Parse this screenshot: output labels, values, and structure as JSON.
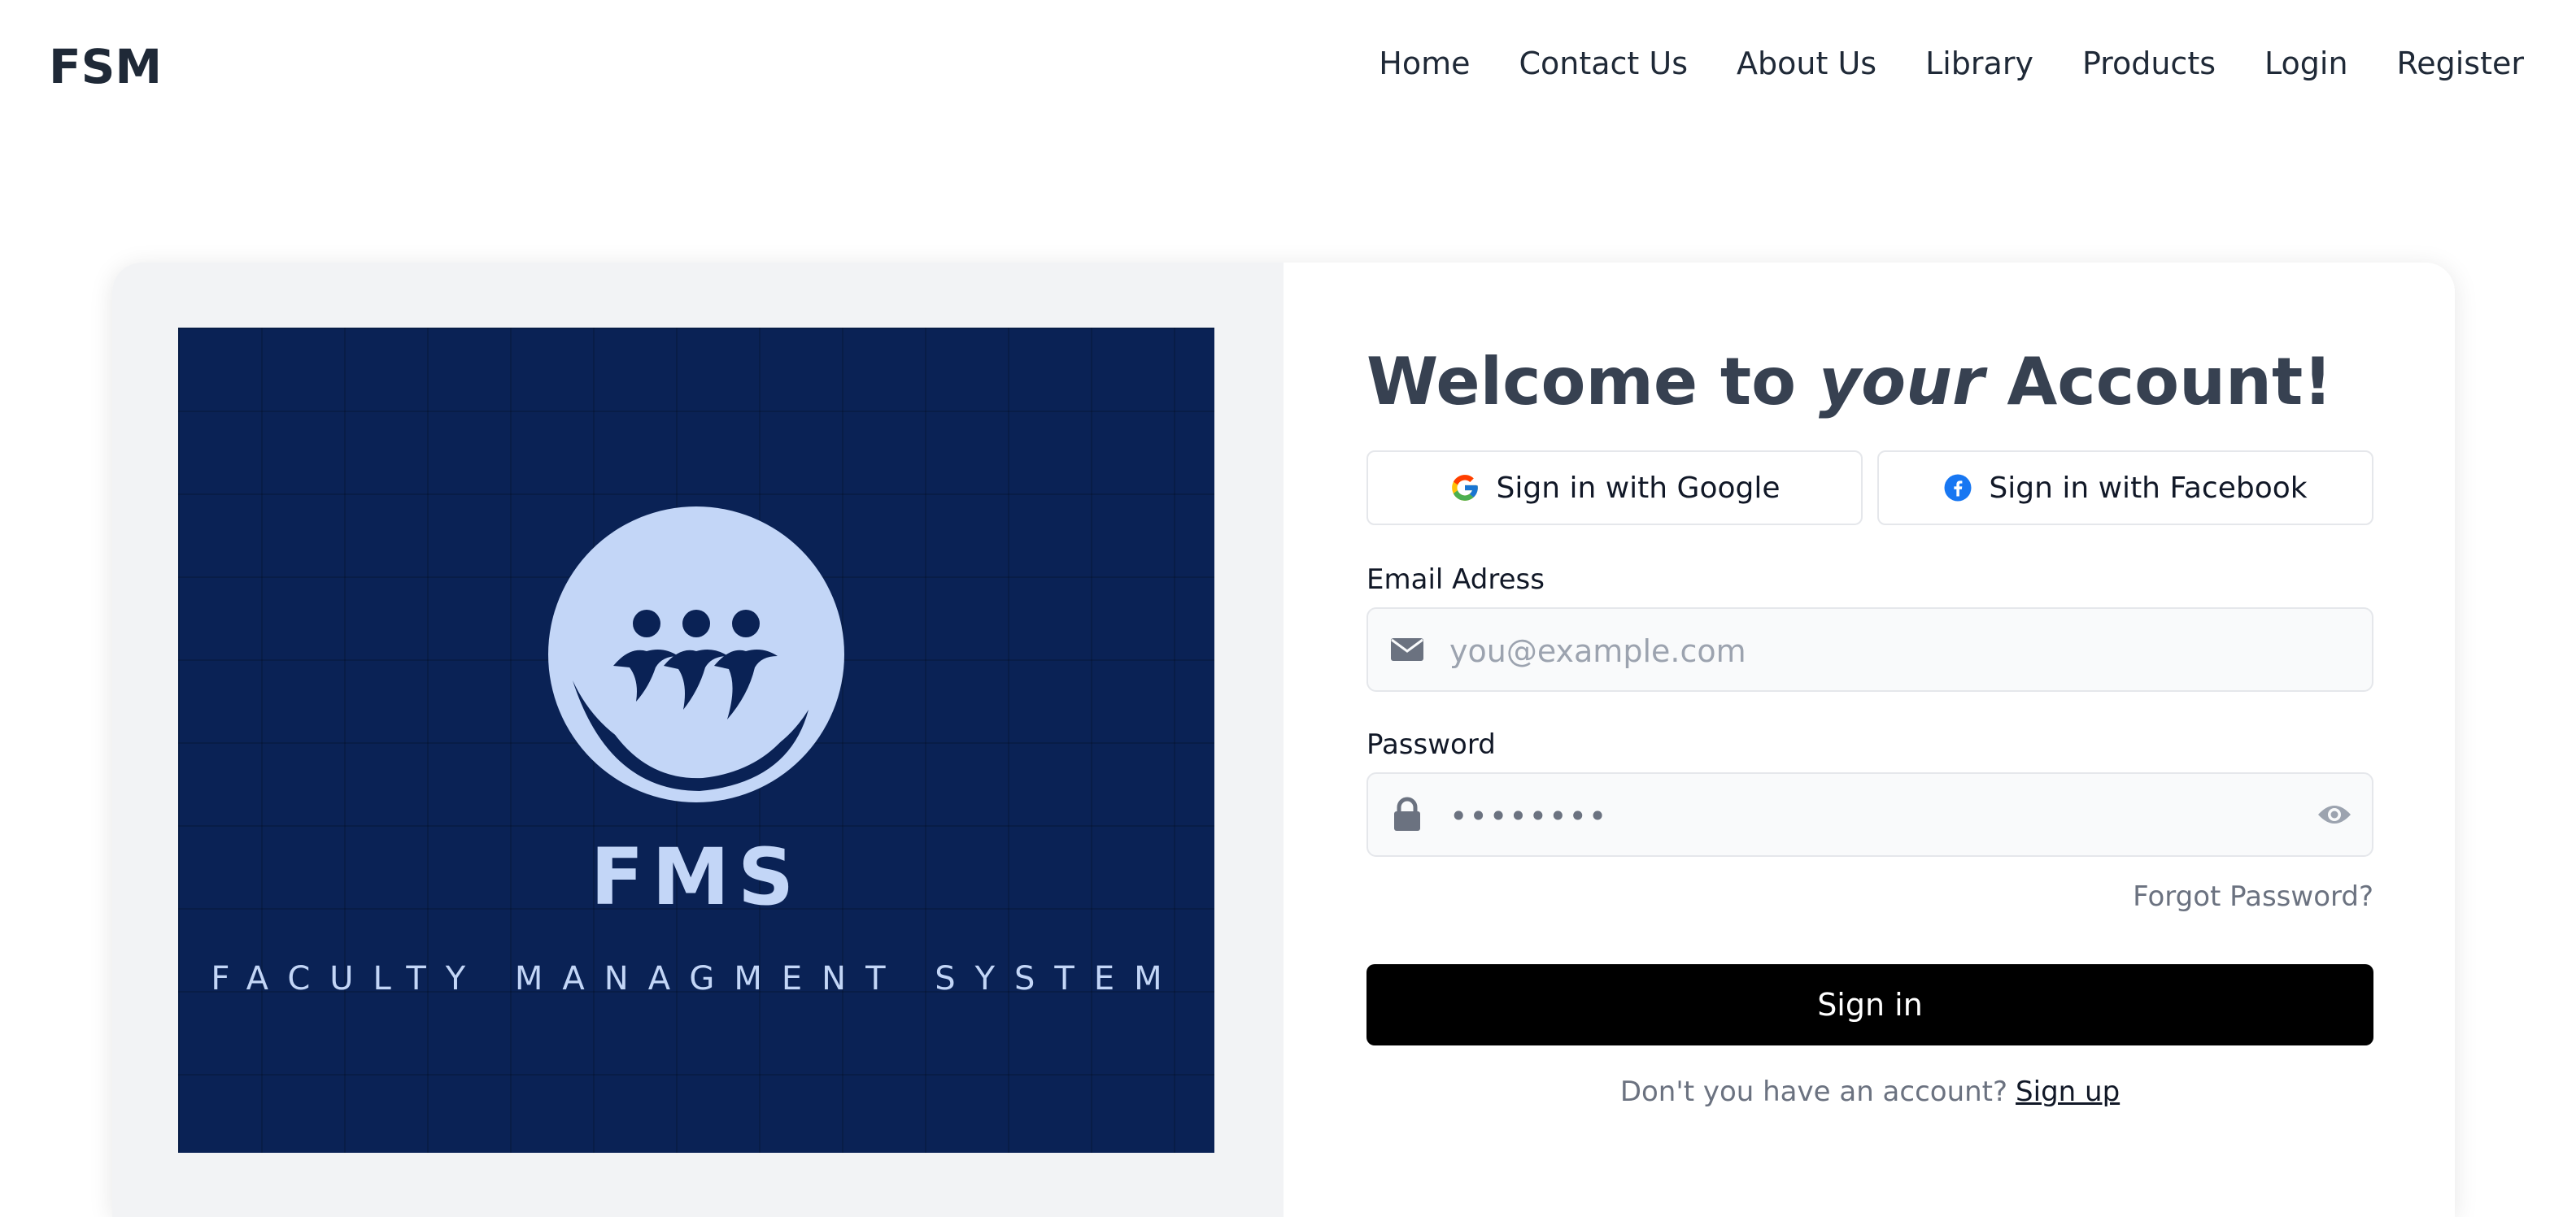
{
  "navbar": {
    "brand": "FSM",
    "links": [
      "Home",
      "Contact Us",
      "About Us",
      "Library",
      "Products",
      "Login",
      "Register"
    ]
  },
  "hero": {
    "title": "FMS",
    "subtitle": "FACULTY MANAGMENT SYSTEM",
    "background_color": "#0a2255",
    "logo_color": "#c3d6f7",
    "logo_icon": "people-wave-circle-icon"
  },
  "form": {
    "heading_start": "Welcome to ",
    "heading_emphasis": "your",
    "heading_end": " Account!",
    "google_label": "Sign in with Google",
    "facebook_label": "Sign in with Facebook",
    "email_label": "Email Adress",
    "email_placeholder": "you@example.com",
    "password_label": "Password",
    "password_value": "••••••••",
    "forgot_label": "Forgot Password?",
    "signin_label": "Sign in",
    "signup_prompt": "Don't you have an account?",
    "signup_link": "Sign up"
  },
  "colors": {
    "signin_button": "#000000",
    "card_left_background": "#f2f3f5",
    "text_muted": "#6b7280"
  }
}
